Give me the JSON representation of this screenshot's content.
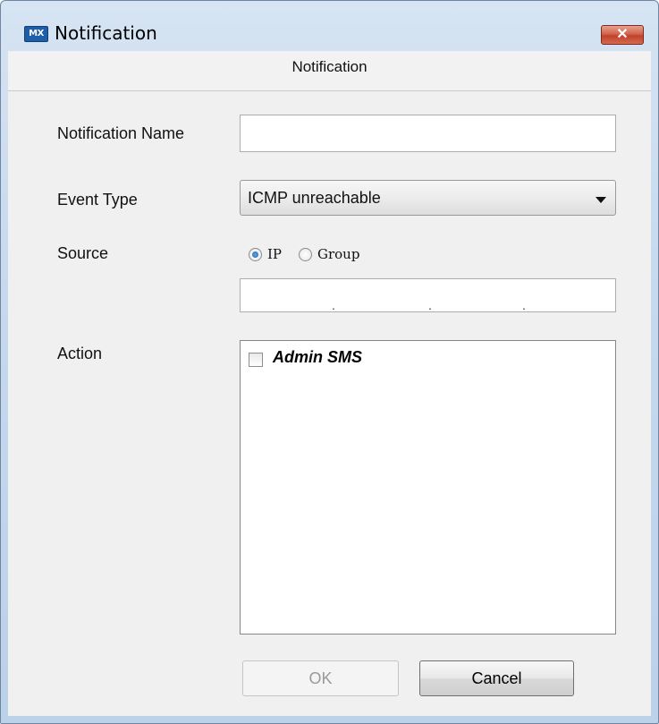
{
  "window": {
    "app_icon_text": "MX",
    "title": "Notification",
    "close_glyph": "✕"
  },
  "header": {
    "title": "Notification"
  },
  "form": {
    "name": {
      "label": "Notification Name",
      "value": ""
    },
    "event_type": {
      "label": "Event Type",
      "selected": "ICMP unreachable"
    },
    "source": {
      "label": "Source",
      "options": [
        {
          "label": "IP",
          "checked": true
        },
        {
          "label": "Group",
          "checked": false
        }
      ],
      "ip_value": "",
      "ip_separator": "."
    },
    "action": {
      "label": "Action",
      "items": [
        {
          "label": "Admin SMS",
          "checked": false
        }
      ]
    }
  },
  "buttons": {
    "ok": {
      "label": "OK",
      "enabled": false
    },
    "cancel": {
      "label": "Cancel",
      "enabled": true
    }
  },
  "colors": {
    "window_frame": "#c6d9ee",
    "close_button": "#c0412a",
    "radio_selected": "#1f5fa6"
  }
}
